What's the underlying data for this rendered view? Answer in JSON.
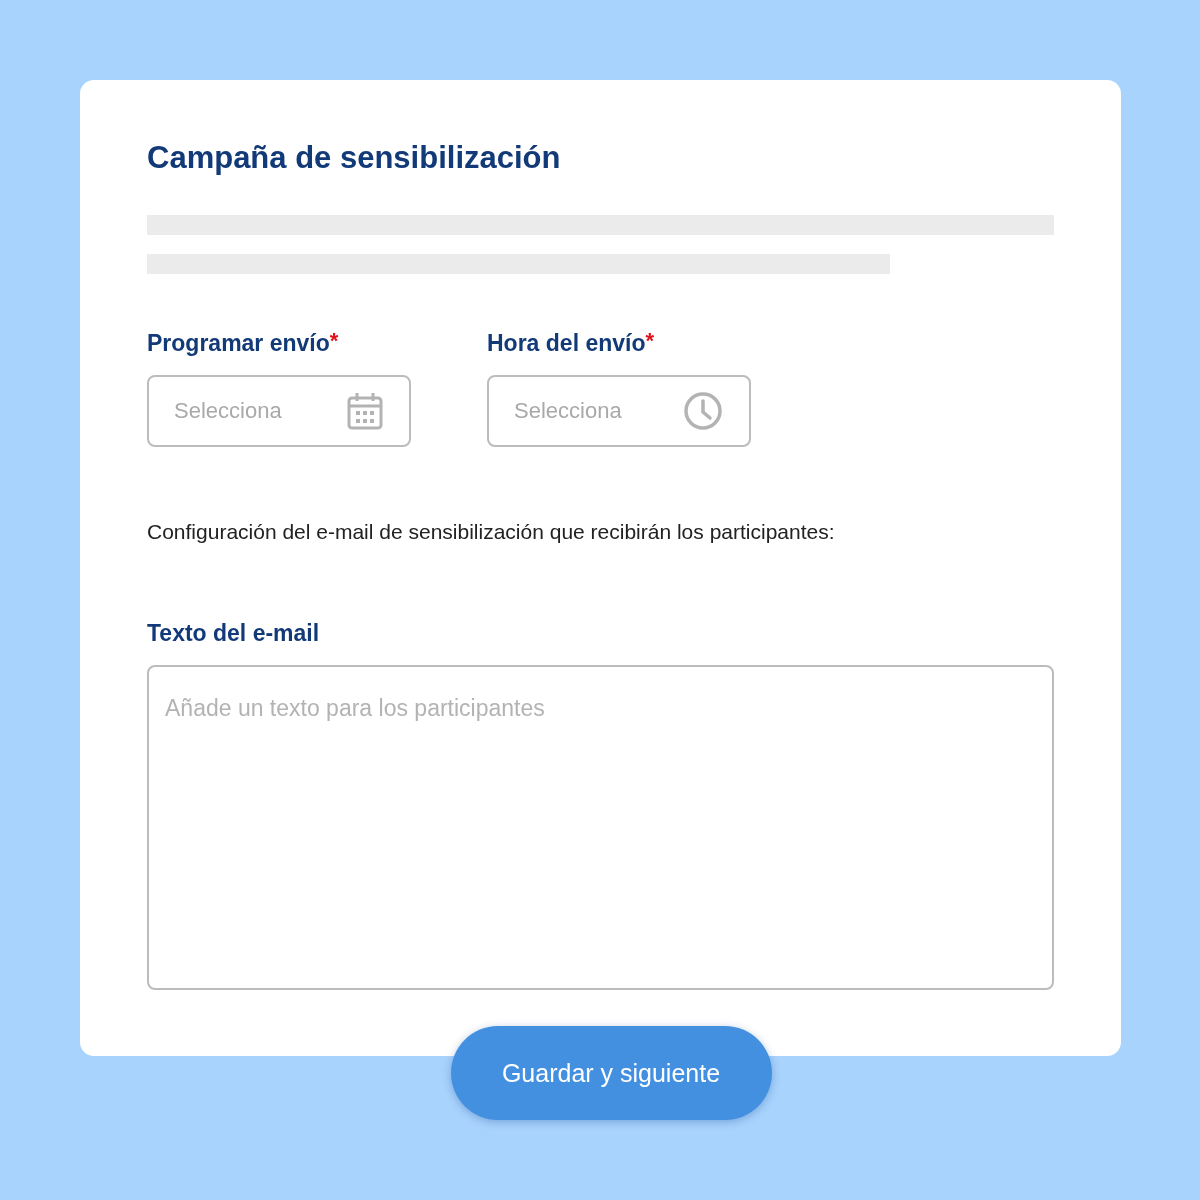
{
  "card": {
    "title": "Campaña de sensibilización",
    "fields": [
      {
        "kind": "date",
        "label": "Programar envío",
        "required_mark": "*",
        "placeholder": "Selecciona"
      },
      {
        "kind": "time",
        "label": "Hora del envío",
        "required_mark": "*",
        "placeholder": "Selecciona"
      }
    ],
    "instructions": "Configuración del e-mail de sensibilización que recibirán los participantes:",
    "email_text": {
      "label": "Texto del e-mail",
      "placeholder": "Añade un texto para los participantes"
    }
  },
  "buttons": [
    "Guardar y siguiente"
  ]
}
